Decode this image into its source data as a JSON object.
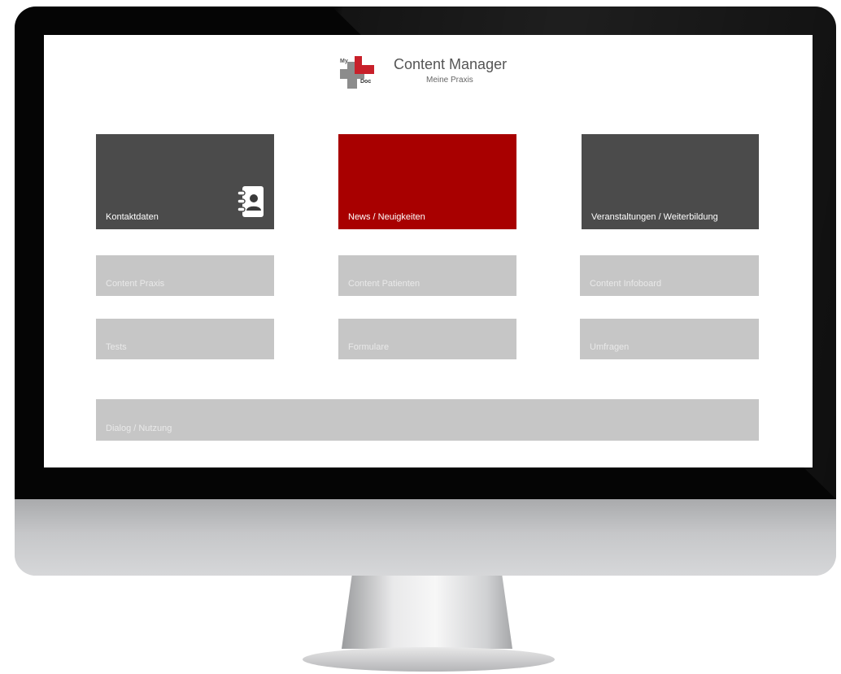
{
  "app": {
    "title": "Content Manager",
    "subtitle": "Meine Praxis",
    "logo_text_top": "My",
    "logo_text_bottom": "Doc"
  },
  "tiles": {
    "row1": [
      {
        "label": "Kontaktdaten",
        "icon": "contact-book-icon"
      },
      {
        "label": "News / Neuigkeiten"
      },
      {
        "label": "Veranstaltungen / Weiterbildung"
      }
    ],
    "row2": [
      {
        "label": "Content Praxis"
      },
      {
        "label": "Content Patienten"
      },
      {
        "label": "Content Infoboard"
      }
    ],
    "row3": [
      {
        "label": "Tests"
      },
      {
        "label": "Formulare"
      },
      {
        "label": "Umfragen"
      }
    ],
    "row4": [
      {
        "label": "Dialog / Nutzung"
      }
    ]
  },
  "colors": {
    "dark_tile": "#4b4b4b",
    "accent_red": "#a80000",
    "light_tile": "#c6c6c6",
    "logo_gray": "#8c8c8c"
  }
}
